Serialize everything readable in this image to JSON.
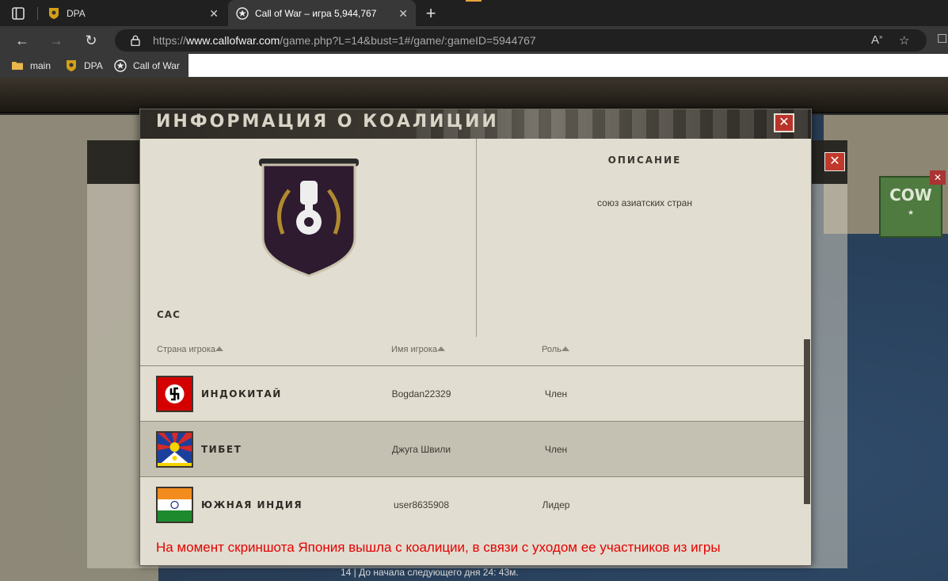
{
  "browser": {
    "tabs": [
      {
        "title": "DPA",
        "active": false
      },
      {
        "title": "Call of War – игра 5,944,767",
        "active": true
      }
    ],
    "url": {
      "prefix": "https://",
      "host": "www.callofwar.com",
      "path": "/game.php?L=14&bust=1#/game/:gameID=5944767"
    },
    "bookmarks": [
      {
        "label": "main",
        "icon": "folder-icon"
      },
      {
        "label": "DPA",
        "icon": "shield-favicon"
      },
      {
        "label": "Call of War",
        "icon": "star-favicon"
      }
    ]
  },
  "modal": {
    "title": "ИНФОРМАЦИЯ О КОАЛИЦИИ",
    "coalition_name": "САС",
    "description_title": "ОПИСАНИЕ",
    "description": "союз азиатских стран",
    "columns": {
      "country": "Страна игрока",
      "player": "Имя игрока",
      "role": "Роль"
    },
    "members": [
      {
        "country": "ИНДОКИТАЙ",
        "player": "Bogdan22329",
        "role": "Член",
        "flag": "swastika-flag"
      },
      {
        "country": "ТИБЕТ",
        "player": "Джуга Швили",
        "role": "Член",
        "flag": "tibet-flag"
      },
      {
        "country": "ЮЖНАЯ ИНДИЯ",
        "player": "user8635908",
        "role": "Лидер",
        "flag": "india-flag"
      }
    ]
  },
  "game": {
    "badge_label": "COW",
    "status_text": "14 | До начала следующего дня 24: 43м."
  },
  "annotation": "На момент скриншота Япония вышла с коалиции, в связи с уходом ее участников из игры",
  "colors": {
    "annotation": "#e50000",
    "close_button": "#b8342a",
    "emblem": "#2e1b30"
  }
}
